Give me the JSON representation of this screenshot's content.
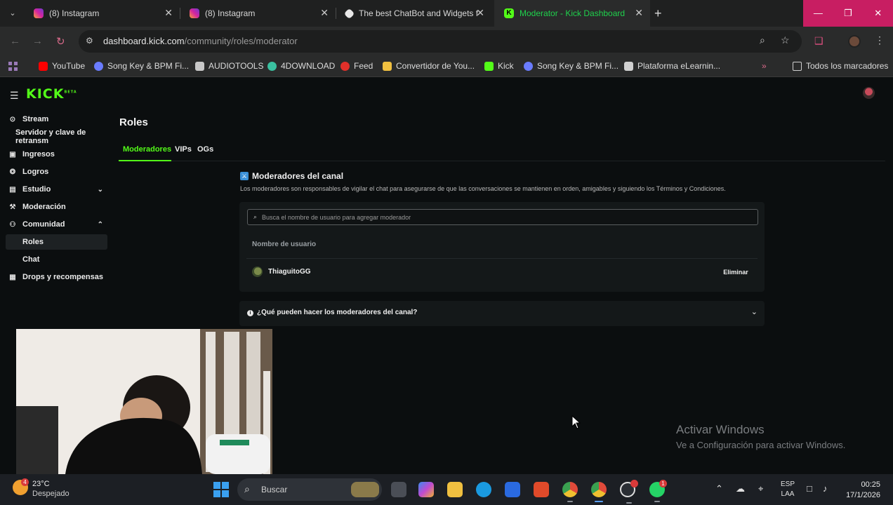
{
  "browser": {
    "tabs": [
      {
        "title": "(8) Instagram",
        "icon": "instagram-icon",
        "active": false
      },
      {
        "title": "(8) Instagram",
        "icon": "instagram-icon",
        "active": false
      },
      {
        "title": "The best ChatBot and Widgets f",
        "icon": "botrix-icon",
        "active": false
      },
      {
        "title": "Moderator - Kick Dashboard",
        "icon": "kick-icon",
        "active": true
      }
    ],
    "url_host": "dashboard.kick.com",
    "url_path": "/community/roles/moderator",
    "bookmarks": [
      {
        "label": "YouTube",
        "color": "#ff0000"
      },
      {
        "label": "Song Key & BPM Fi...",
        "color": "#6a7cff"
      },
      {
        "label": "AUDIOTOOLS",
        "color": "#c8c8c8"
      },
      {
        "label": "4DOWNLOAD",
        "color": "#3ac0a0"
      },
      {
        "label": "Feed",
        "color": "#e0302a"
      },
      {
        "label": "Convertidor de You...",
        "color": "#f0c040"
      },
      {
        "label": "Kick",
        "color": "#53fc18"
      },
      {
        "label": "Song Key & BPM Fi...",
        "color": "#6a7cff"
      },
      {
        "label": "Plataforma eLearnin...",
        "color": "#d0d0d0"
      }
    ],
    "all_bookmarks_label": "Todos los marcadores"
  },
  "kick": {
    "logo": "KICK",
    "logo_sup": "BETA",
    "accent": "#53fc18",
    "sidebar": [
      {
        "label": "Stream",
        "icon": "stream-icon"
      },
      {
        "label": "Servidor y clave de retransm",
        "icon": ""
      },
      {
        "label": "Ingresos",
        "icon": "wallet-icon"
      },
      {
        "label": "Logros",
        "icon": "trophy-icon"
      },
      {
        "label": "Estudio",
        "icon": "studio-icon"
      },
      {
        "label": "Moderación",
        "icon": "wrench-icon"
      },
      {
        "label": "Comunidad",
        "icon": "community-icon"
      },
      {
        "label": "Roles",
        "icon": ""
      },
      {
        "label": "Chat",
        "icon": ""
      },
      {
        "label": "Drops y recompensas",
        "icon": "drops-icon"
      }
    ],
    "page_title": "Roles",
    "role_tabs": [
      "Moderadores",
      "VIPs",
      "OGs"
    ],
    "section_title": "Moderadores del canal",
    "section_desc": "Los moderadores son responsables de vigilar el chat para asegurarse de que las conversaciones se mantienen en orden, amigables y siguiendo los Términos y Condiciones.",
    "search_placeholder": "Busca el nombre de usuario para agregar moderador",
    "column_header": "Nombre de usuario",
    "moderators": [
      {
        "name": "ThiaguitoGG",
        "action": "Eliminar"
      }
    ],
    "faq_question": "¿Qué pueden hacer los moderadores del canal?"
  },
  "watermark": {
    "title": "Activar Windows",
    "subtitle": "Ve a Configuración para activar Windows."
  },
  "taskbar": {
    "weather_temp": "23°C",
    "weather_desc": "Despejado",
    "weather_badge": "4",
    "search_label": "Buscar",
    "lang_1": "ESP",
    "lang_2": "LAA",
    "time": "00:25",
    "date": "17/1/2026",
    "whatsapp_badge": "1"
  }
}
